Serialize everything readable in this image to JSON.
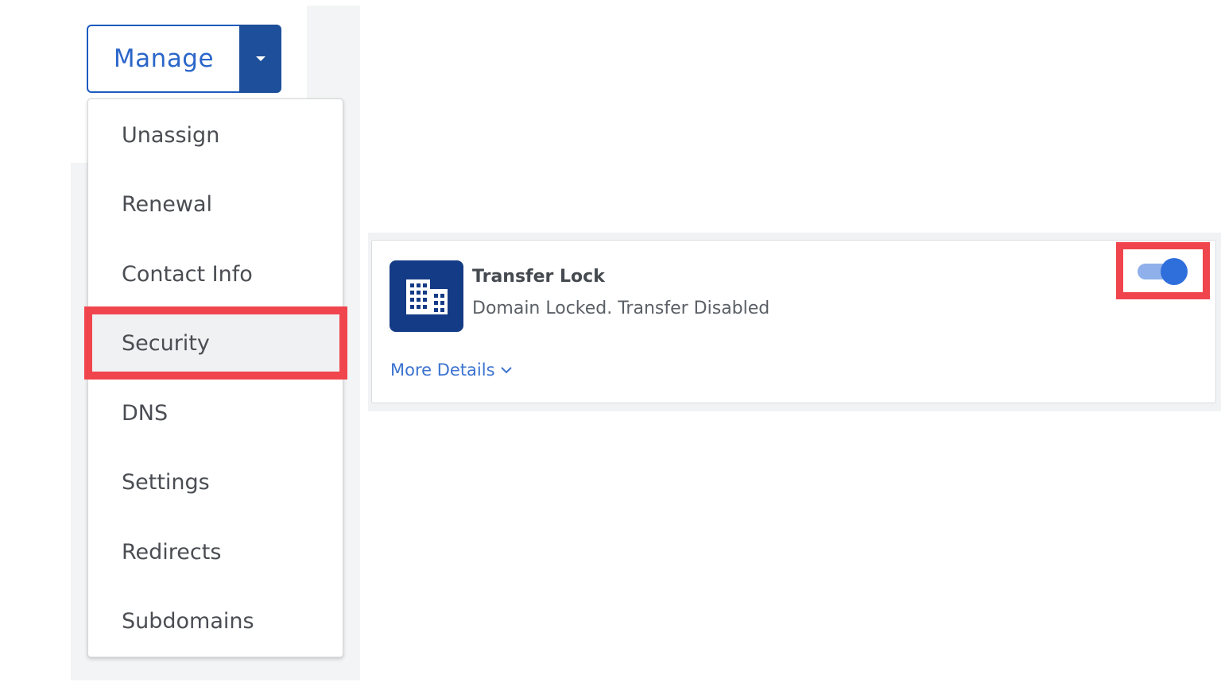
{
  "manage": {
    "label": "Manage",
    "caret_icon": "caret-down-icon"
  },
  "menu": {
    "items": [
      {
        "label": "Unassign"
      },
      {
        "label": "Renewal"
      },
      {
        "label": "Contact Info"
      },
      {
        "label": "Security",
        "active": true
      },
      {
        "label": "DNS"
      },
      {
        "label": "Settings"
      },
      {
        "label": "Redirects"
      },
      {
        "label": "Subdomains"
      }
    ]
  },
  "card": {
    "icon": "building-icon",
    "title": "Transfer Lock",
    "subtitle": "Domain Locked. Transfer Disabled",
    "more_details": "More Details",
    "toggle_on": true
  },
  "colors": {
    "brand_blue": "#1d4f9a",
    "link_blue": "#3b73d0",
    "highlight_red": "#f0454d",
    "tile_navy": "#143b85"
  }
}
